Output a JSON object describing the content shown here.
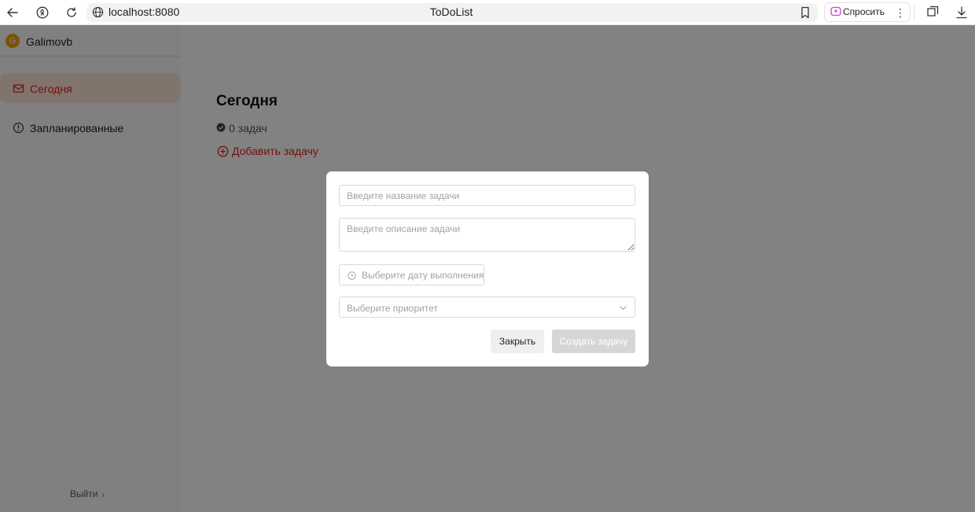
{
  "browser": {
    "url": "localhost:8080",
    "page_title": "ToDoList",
    "ask_label": "Спросить",
    "menu_label": "⋮"
  },
  "sidebar": {
    "user": {
      "initial": "G",
      "name": "Galimovb"
    },
    "items": [
      {
        "label": "Сегодня",
        "icon": "mail-icon",
        "active": true
      },
      {
        "label": "Запланированные",
        "icon": "info-circle-icon",
        "active": false
      }
    ],
    "logout_label": "Выйти",
    "logout_chevron": "›"
  },
  "main": {
    "title": "Сегодня",
    "task_count": "0 задач",
    "add_task_label": "Добавить задачу"
  },
  "modal": {
    "title_placeholder": "Введите название задачи",
    "description_placeholder": "Введите описание задачи",
    "date_placeholder": "Выберите дату выполнения",
    "priority_placeholder": "Выберите приоритет",
    "close_label": "Закрыть",
    "create_label": "Создать задачу"
  },
  "colors": {
    "accent": "#e0201b",
    "active_item_bg": "#fde3d6",
    "avatar_bg": "#f2a102",
    "overlay": "rgba(0,0,0,0.49)"
  }
}
